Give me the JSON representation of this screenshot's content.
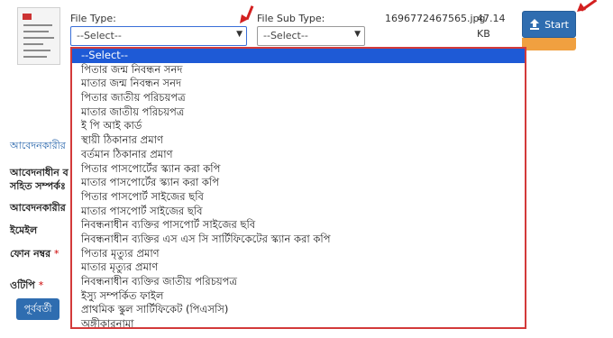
{
  "file_type": {
    "label": "File Type:",
    "selected": "--Select--"
  },
  "file_sub_type": {
    "label": "File Sub Type:",
    "selected": "--Select--"
  },
  "file": {
    "name": "1696772467565.jpg",
    "size_value": "47.14",
    "size_unit": "KB"
  },
  "start_button": {
    "label": "Start",
    "icon": "upload-icon"
  },
  "form": {
    "section_title": "আবেদনকারীর",
    "row1_line1": "আবেদনাধীন ব",
    "row1_line2": "সহিত সম্পর্কঃ",
    "row2": "আবেদনকারীর",
    "row3": "ইমেইল",
    "row4": "ফোন নম্বর",
    "row5": "ওটিপি",
    "required_mark": "*",
    "prev_button": "পূর্ববর্তী"
  },
  "dropdown_options": [
    "--Select--",
    "পিতার জন্ম নিবন্ধন সনদ",
    "মাতার জন্ম নিবন্ধন সনদ",
    "পিতার জাতীয় পরিচয়পত্র",
    "মাতার জাতীয় পরিচয়পত্র",
    "ই পি আই কার্ড",
    "স্থায়ী ঠিকানার প্রমাণ",
    "বর্তমান ঠিকানার প্রমাণ",
    "পিতার পাসপোর্টের স্ক্যান করা কপি",
    "মাতার পাসপোর্টের স্ক্যান করা কপি",
    "পিতার পাসপোর্ট সাইজের ছবি",
    "মাতার পাসপোর্ট সাইজের ছবি",
    "নিবন্ধনাধীন ব্যক্তির পাসপোর্ট সাইজের ছবি",
    "নিবন্ধনাধীন ব্যক্তির এস এস সি সার্টিফিকেটের স্ক্যান করা কপি",
    "পিতার মৃত্যুর প্রমাণ",
    "মাতার মৃত্যুর প্রমাণ",
    "নিবন্ধনাধীন ব্যক্তির জাতীয় পরিচয়পত্র",
    "ইস্যু সম্পর্কিত ফাইল",
    "প্রাথমিক স্কুল সার্টিফিকেট (পিএসসি)",
    "অঙ্গীকারনামা"
  ],
  "colors": {
    "accent": "#2f6db0",
    "highlight": "#1e5ad6",
    "annotation": "#d32020",
    "dropdown_border": "#d33a3a"
  }
}
